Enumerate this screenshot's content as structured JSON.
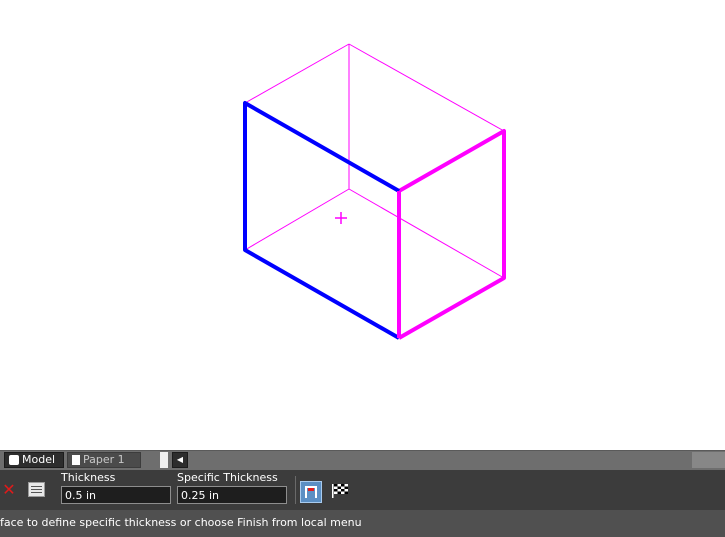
{
  "tabs": {
    "model_label": "Model",
    "paper_label": "Paper 1"
  },
  "toolbar": {
    "thickness_label": "Thickness",
    "thickness_value": "0.5 in",
    "specific_thickness_label": "Specific Thickness",
    "specific_thickness_value": "0.25 in"
  },
  "status": {
    "prompt": "face to define specific thickness or choose Finish from local menu"
  },
  "colors": {
    "selected_face": "#0000ff",
    "highlight_edges": "#ff00ff",
    "toolbar_bg": "#3c3c3c",
    "status_bg": "#505050"
  },
  "icons": {
    "cancel": "close-icon",
    "table": "table-icon",
    "finish_face": "face-select-icon",
    "finish": "checkered-flag-icon",
    "model_tab": "camera-icon",
    "paper_tab": "sheet-icon"
  }
}
